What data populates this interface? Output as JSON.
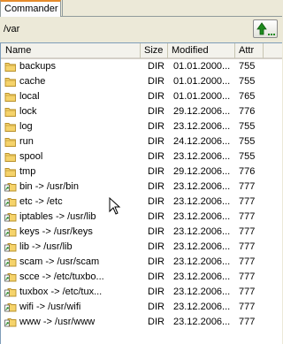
{
  "tab": {
    "label": "Commander"
  },
  "path": {
    "value": "/var"
  },
  "columns": {
    "name": "Name",
    "size": "Size",
    "modified": "Modified",
    "attr": "Attr"
  },
  "rows": [
    {
      "icon": "folder-icon",
      "name": "backups",
      "size": "DIR",
      "modified": "01.01.2000...",
      "attr": "755"
    },
    {
      "icon": "folder-icon",
      "name": "cache",
      "size": "DIR",
      "modified": "01.01.2000...",
      "attr": "755"
    },
    {
      "icon": "folder-icon",
      "name": "local",
      "size": "DIR",
      "modified": "01.01.2000...",
      "attr": "765"
    },
    {
      "icon": "folder-icon",
      "name": "lock",
      "size": "DIR",
      "modified": "29.12.2006...",
      "attr": "776"
    },
    {
      "icon": "folder-icon",
      "name": "log",
      "size": "DIR",
      "modified": "23.12.2006...",
      "attr": "755"
    },
    {
      "icon": "folder-icon",
      "name": "run",
      "size": "DIR",
      "modified": "24.12.2006...",
      "attr": "755"
    },
    {
      "icon": "folder-icon",
      "name": "spool",
      "size": "DIR",
      "modified": "23.12.2006...",
      "attr": "755"
    },
    {
      "icon": "folder-icon",
      "name": "tmp",
      "size": "DIR",
      "modified": "29.12.2006...",
      "attr": "776"
    },
    {
      "icon": "symlink-icon",
      "name": "bin -> /usr/bin",
      "size": "DIR",
      "modified": "23.12.2006...",
      "attr": "777"
    },
    {
      "icon": "symlink-icon",
      "name": "etc -> /etc",
      "size": "DIR",
      "modified": "23.12.2006...",
      "attr": "777"
    },
    {
      "icon": "symlink-icon",
      "name": "iptables -> /usr/lib",
      "size": "DIR",
      "modified": "23.12.2006...",
      "attr": "777"
    },
    {
      "icon": "symlink-icon",
      "name": "keys -> /usr/keys",
      "size": "DIR",
      "modified": "23.12.2006...",
      "attr": "777"
    },
    {
      "icon": "symlink-icon",
      "name": "lib -> /usr/lib",
      "size": "DIR",
      "modified": "23.12.2006...",
      "attr": "777"
    },
    {
      "icon": "symlink-icon",
      "name": "scam -> /usr/scam",
      "size": "DIR",
      "modified": "23.12.2006...",
      "attr": "777"
    },
    {
      "icon": "symlink-icon",
      "name": "scce -> /etc/tuxbo...",
      "size": "DIR",
      "modified": "23.12.2006...",
      "attr": "777"
    },
    {
      "icon": "symlink-icon",
      "name": "tuxbox -> /etc/tux...",
      "size": "DIR",
      "modified": "23.12.2006...",
      "attr": "777"
    },
    {
      "icon": "symlink-icon",
      "name": "wifi -> /usr/wifi",
      "size": "DIR",
      "modified": "23.12.2006...",
      "attr": "777"
    },
    {
      "icon": "symlink-icon",
      "name": "www -> /usr/www",
      "size": "DIR",
      "modified": "23.12.2006...",
      "attr": "777"
    }
  ],
  "colors": {
    "folder": "#f5d36b",
    "folder_edge": "#b8902a",
    "link_arrow": "#2a8a2a",
    "tab_accent": "#e68b2c"
  }
}
